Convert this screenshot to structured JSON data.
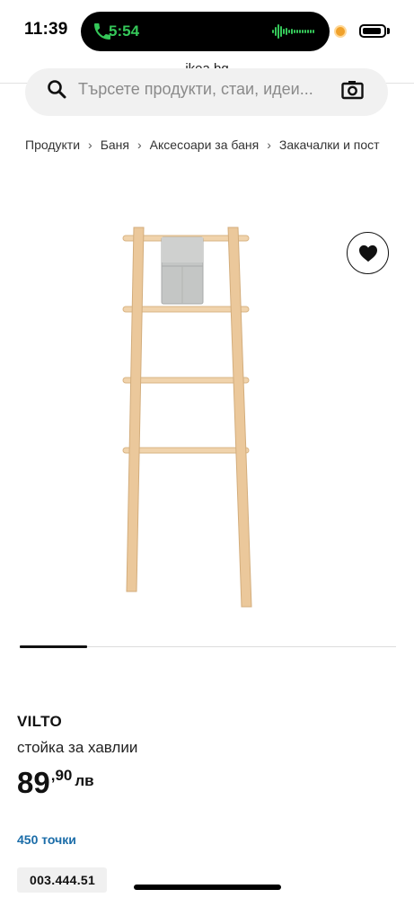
{
  "status_bar": {
    "time": "11:39",
    "call_time": "5:54",
    "call_color": "#35c759",
    "indicator_color": "#f0a12a",
    "icons": [
      "phone-icon",
      "waveform-icon",
      "battery-icon"
    ]
  },
  "browser": {
    "url": "ikea.bg"
  },
  "search": {
    "placeholder": "Търсете продукти, стаи, идеи...",
    "icons": [
      "search-icon",
      "camera-icon"
    ]
  },
  "breadcrumb": {
    "items": [
      "Продукти",
      "Баня",
      "Аксесоари за баня",
      "Закачалки и пост"
    ],
    "separator": "›"
  },
  "gallery": {
    "wishlist_icon": "heart-icon",
    "current_index": 1,
    "progress": 0.18
  },
  "product": {
    "name": "VILTO",
    "description": "стойка за хавлии",
    "price_integer": "89",
    "price_decimal": ",90",
    "currency": "лв",
    "points": "450 точки",
    "article_number": "003.444.51"
  },
  "colors": {
    "accent_link": "#1a6ca8",
    "wood": "#e9c79d"
  }
}
